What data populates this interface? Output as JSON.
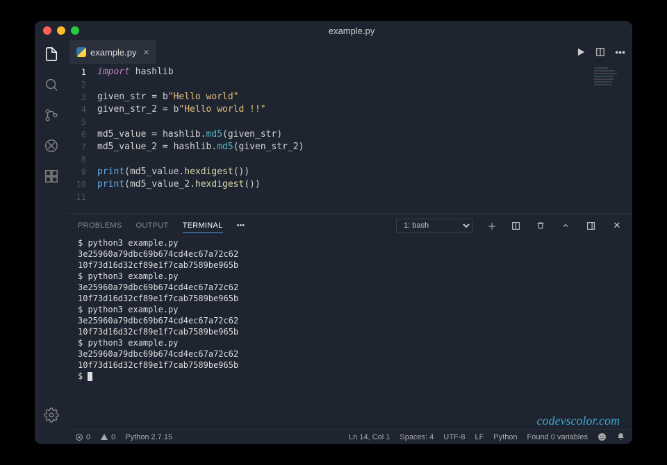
{
  "window": {
    "title": "example.py"
  },
  "tabs": [
    {
      "label": "example.py",
      "icon": "python"
    }
  ],
  "editor": {
    "lines": [
      {
        "num": "1",
        "tokens": [
          [
            "kw",
            "import"
          ],
          [
            "sp",
            " "
          ],
          [
            "mod",
            "hashlib"
          ]
        ]
      },
      {
        "num": "2",
        "tokens": []
      },
      {
        "num": "3",
        "tokens": [
          [
            "var",
            "given_str"
          ],
          [
            "sp",
            " "
          ],
          [
            "op",
            "="
          ],
          [
            "sp",
            " "
          ],
          [
            "mod",
            "b"
          ],
          [
            "str",
            "\"Hello world\""
          ]
        ]
      },
      {
        "num": "4",
        "tokens": [
          [
            "var",
            "given_str_2"
          ],
          [
            "sp",
            " "
          ],
          [
            "op",
            "="
          ],
          [
            "sp",
            " "
          ],
          [
            "mod",
            "b"
          ],
          [
            "str",
            "\"Hello world !!\""
          ]
        ]
      },
      {
        "num": "5",
        "tokens": []
      },
      {
        "num": "6",
        "tokens": [
          [
            "var",
            "md5_value"
          ],
          [
            "sp",
            " "
          ],
          [
            "op",
            "="
          ],
          [
            "sp",
            " "
          ],
          [
            "var",
            "hashlib"
          ],
          [
            "op",
            "."
          ],
          [
            "fn",
            "md5"
          ],
          [
            "op",
            "("
          ],
          [
            "var",
            "given_str"
          ],
          [
            "op",
            ")"
          ]
        ]
      },
      {
        "num": "7",
        "tokens": [
          [
            "var",
            "md5_value_2"
          ],
          [
            "sp",
            " "
          ],
          [
            "op",
            "="
          ],
          [
            "sp",
            " "
          ],
          [
            "var",
            "hashlib"
          ],
          [
            "op",
            "."
          ],
          [
            "fn",
            "md5"
          ],
          [
            "op",
            "("
          ],
          [
            "var",
            "given_str_2"
          ],
          [
            "op",
            ")"
          ]
        ]
      },
      {
        "num": "8",
        "tokens": []
      },
      {
        "num": "9",
        "tokens": [
          [
            "builtin",
            "print"
          ],
          [
            "op",
            "("
          ],
          [
            "var",
            "md5_value"
          ],
          [
            "op",
            "."
          ],
          [
            "call",
            "hexdigest"
          ],
          [
            "op",
            "())"
          ]
        ]
      },
      {
        "num": "10",
        "tokens": [
          [
            "builtin",
            "print"
          ],
          [
            "op",
            "("
          ],
          [
            "var",
            "md5_value_2"
          ],
          [
            "op",
            "."
          ],
          [
            "call",
            "hexdigest"
          ],
          [
            "op",
            "())"
          ]
        ]
      },
      {
        "num": "11",
        "tokens": []
      }
    ]
  },
  "panel": {
    "tabs": {
      "problems": "PROBLEMS",
      "output": "OUTPUT",
      "terminal": "TERMINAL"
    },
    "terminal_select": "1: bash",
    "terminal_lines": [
      "$ python3 example.py",
      "3e25960a79dbc69b674cd4ec67a72c62",
      "10f73d16d32cf89e1f7cab7589be965b",
      "$ python3 example.py",
      "3e25960a79dbc69b674cd4ec67a72c62",
      "10f73d16d32cf89e1f7cab7589be965b",
      "$ python3 example.py",
      "3e25960a79dbc69b674cd4ec67a72c62",
      "10f73d16d32cf89e1f7cab7589be965b",
      "$ python3 example.py",
      "3e25960a79dbc69b674cd4ec67a72c62",
      "10f73d16d32cf89e1f7cab7589be965b",
      "$ "
    ]
  },
  "status": {
    "errors": "0",
    "warnings": "0",
    "interpreter": "Python 2.7.15",
    "cursor": "Ln 14, Col 1",
    "spaces": "Spaces: 4",
    "encoding": "UTF-8",
    "eol": "LF",
    "language": "Python",
    "variables": "Found 0 variables"
  },
  "watermark": "codevscolor.com"
}
